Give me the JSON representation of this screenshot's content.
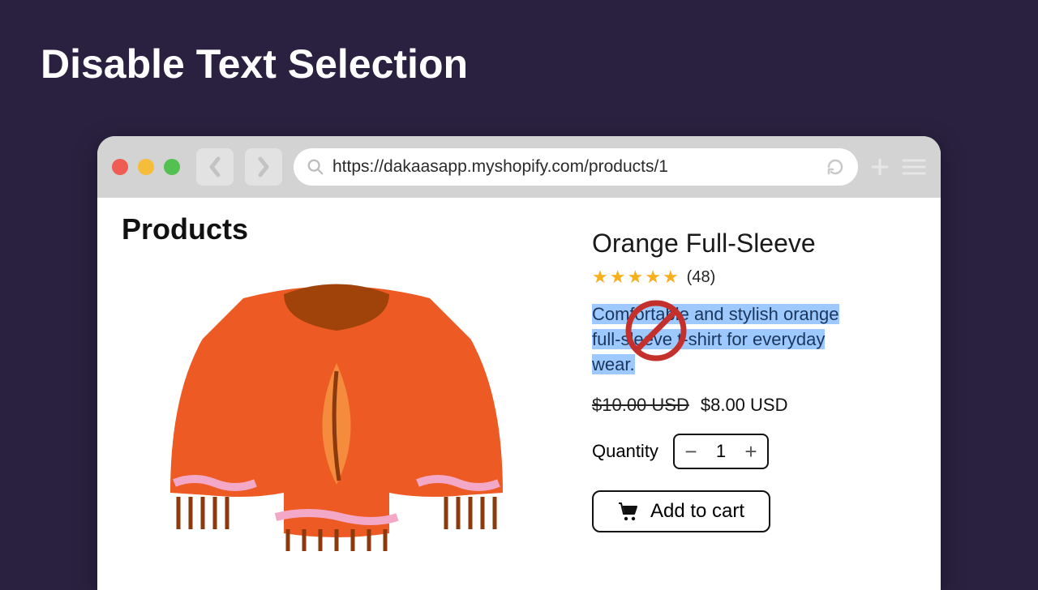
{
  "page": {
    "title": "Disable Text Selection"
  },
  "browser": {
    "url": "https://dakaasapp.myshopify.com/products/1"
  },
  "section": {
    "heading": "Products"
  },
  "product": {
    "title": "Orange Full-Sleeve",
    "rating_count": "(48)",
    "stars": 5,
    "description": "Comfortable and stylish orange full-sleeve t-shirt for everyday wear.",
    "old_price": "$10.00 USD",
    "price": "$8.00 USD",
    "quantity_label": "Quantity",
    "quantity_value": "1",
    "add_to_cart_label": "Add  to cart"
  },
  "icons": {
    "minus": "−",
    "plus": "+"
  }
}
